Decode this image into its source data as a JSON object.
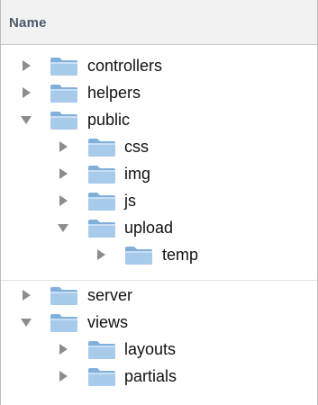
{
  "header": {
    "label": "Name"
  },
  "rows": [
    {
      "label": "controllers",
      "expanded": false,
      "icon": "folder-icon"
    },
    {
      "label": "helpers",
      "expanded": false,
      "icon": "folder-icon"
    },
    {
      "label": "public",
      "expanded": true,
      "icon": "folder-icon"
    },
    {
      "label": "css",
      "expanded": false,
      "icon": "folder-icon"
    },
    {
      "label": "img",
      "expanded": false,
      "icon": "folder-icon"
    },
    {
      "label": "js",
      "expanded": false,
      "icon": "folder-icon"
    },
    {
      "label": "upload",
      "expanded": true,
      "icon": "folder-icon"
    },
    {
      "label": "temp",
      "expanded": false,
      "icon": "folder-icon"
    },
    {
      "label": "server",
      "expanded": false,
      "icon": "folder-icon"
    },
    {
      "label": "views",
      "expanded": true,
      "icon": "folder-icon"
    },
    {
      "label": "layouts",
      "expanded": false,
      "icon": "folder-icon"
    },
    {
      "label": "partials",
      "expanded": false,
      "icon": "folder-icon"
    }
  ],
  "colors": {
    "folder_body": "#9fc3e6",
    "folder_tab": "#7fb0dc",
    "disclosure": "#8c8c8c"
  }
}
